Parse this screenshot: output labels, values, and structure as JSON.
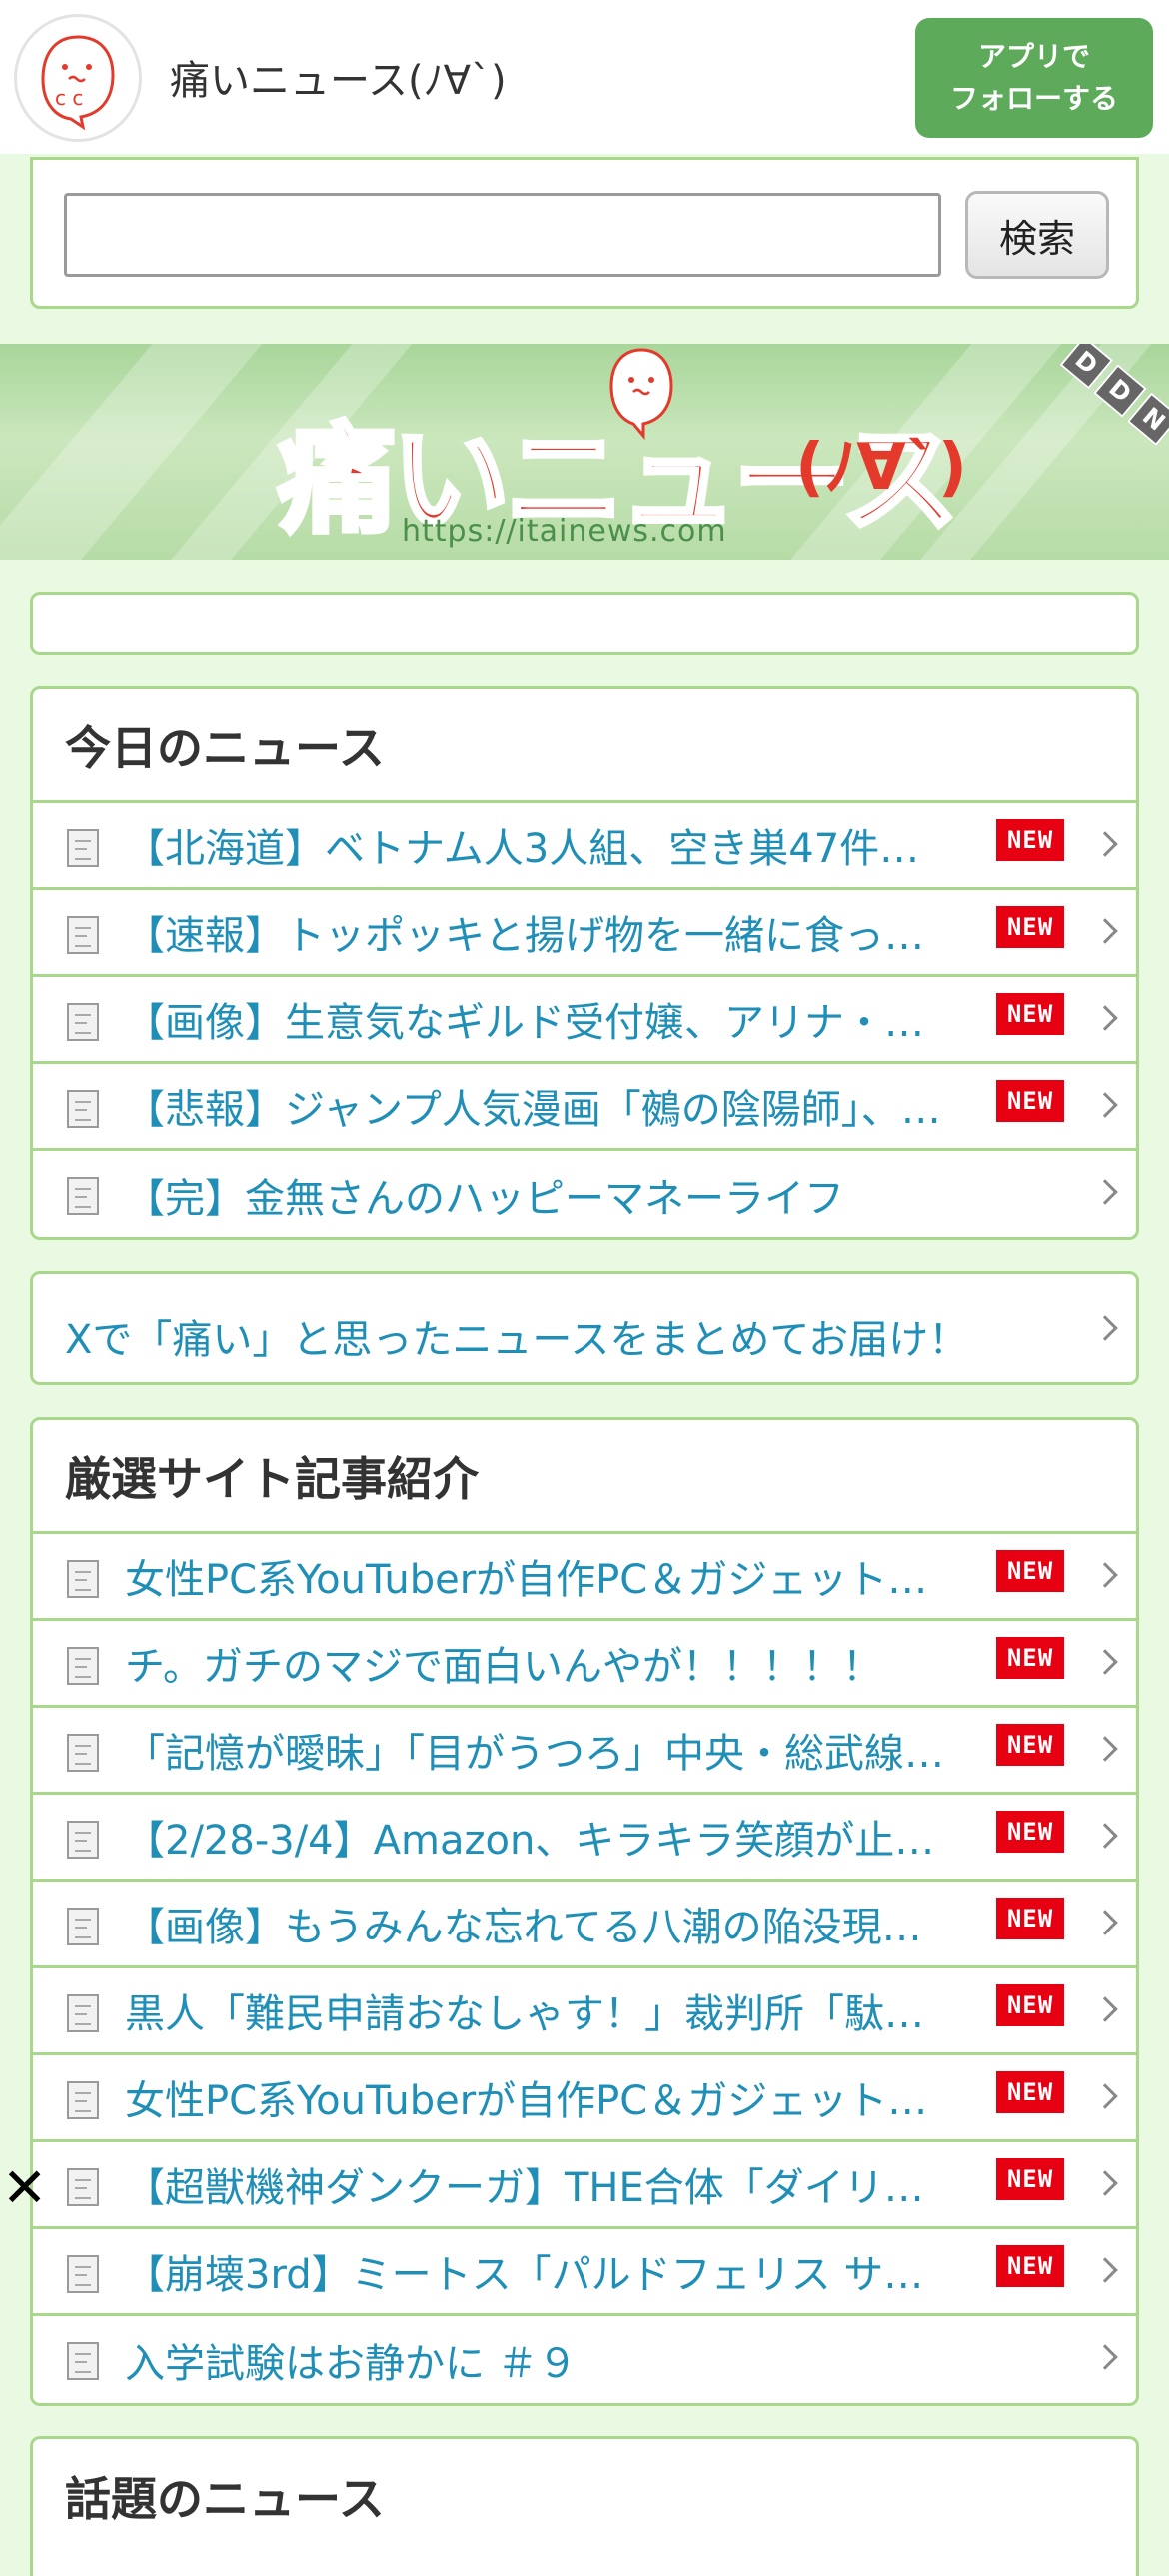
{
  "header": {
    "site_title": "痛いニュース(ﾉ∀`)",
    "follow_line1": "アプリで",
    "follow_line2": "フォローする"
  },
  "search": {
    "input_value": "",
    "button_label": "検索"
  },
  "banner": {
    "logo_text": "痛いニュース",
    "logo_face": "(ﾉ∀`)",
    "url": "https://itainews.com",
    "ddn_letters": [
      "D",
      "D",
      "N"
    ]
  },
  "today": {
    "title": "今日のニュース",
    "items": [
      {
        "text": "【北海道】ベトナム人3人組、空き巣47件…",
        "new": true
      },
      {
        "text": "【速報】トッポッキと揚げ物を一緒に食っ…",
        "new": true
      },
      {
        "text": "【画像】生意気なギルド受付嬢、アリナ・…",
        "new": true
      },
      {
        "text": "【悲報】ジャンプ人気漫画「鵺の陰陽師」、…",
        "new": true
      },
      {
        "text": "【完】金無さんのハッピーマネーライフ",
        "new": false
      }
    ]
  },
  "x_link": {
    "text": "Xで「痛い」と思ったニュースをまとめてお届け！"
  },
  "selected": {
    "title": "厳選サイト記事紹介",
    "items": [
      {
        "text": "女性PC系YouTuberが自作PC＆ガジェット…",
        "new": true
      },
      {
        "text": "チ。ガチのマジで面白いんやが！！！！！",
        "new": true
      },
      {
        "text": "「記憶が曖昧」「目がうつろ」中央・総武線…",
        "new": true
      },
      {
        "text": "【2/28-3/4】Amazon、キラキラ笑顔が止…",
        "new": true
      },
      {
        "text": "【画像】もうみんな忘れてる八潮の陥没現…",
        "new": true
      },
      {
        "text": "黒人「難民申請おなしゃす！」裁判所「駄…",
        "new": true
      },
      {
        "text": "女性PC系YouTuberが自作PC＆ガジェット…",
        "new": true
      },
      {
        "text": "【超獣機神ダンクーガ】THE合体「ダイリ…",
        "new": true
      },
      {
        "text": "【崩壊3rd】ミートス「パルドフェリス サ…",
        "new": true
      },
      {
        "text": "入学試験はお静かに ＃９",
        "new": false
      }
    ]
  },
  "topic": {
    "title": "話題のニュース"
  },
  "badge_label": "NEW",
  "close_label": "✕",
  "colors": {
    "accent_green": "#5daa5b",
    "border_green": "#a8d98a",
    "link_blue": "#1f8fb8",
    "new_red": "#e60012"
  }
}
